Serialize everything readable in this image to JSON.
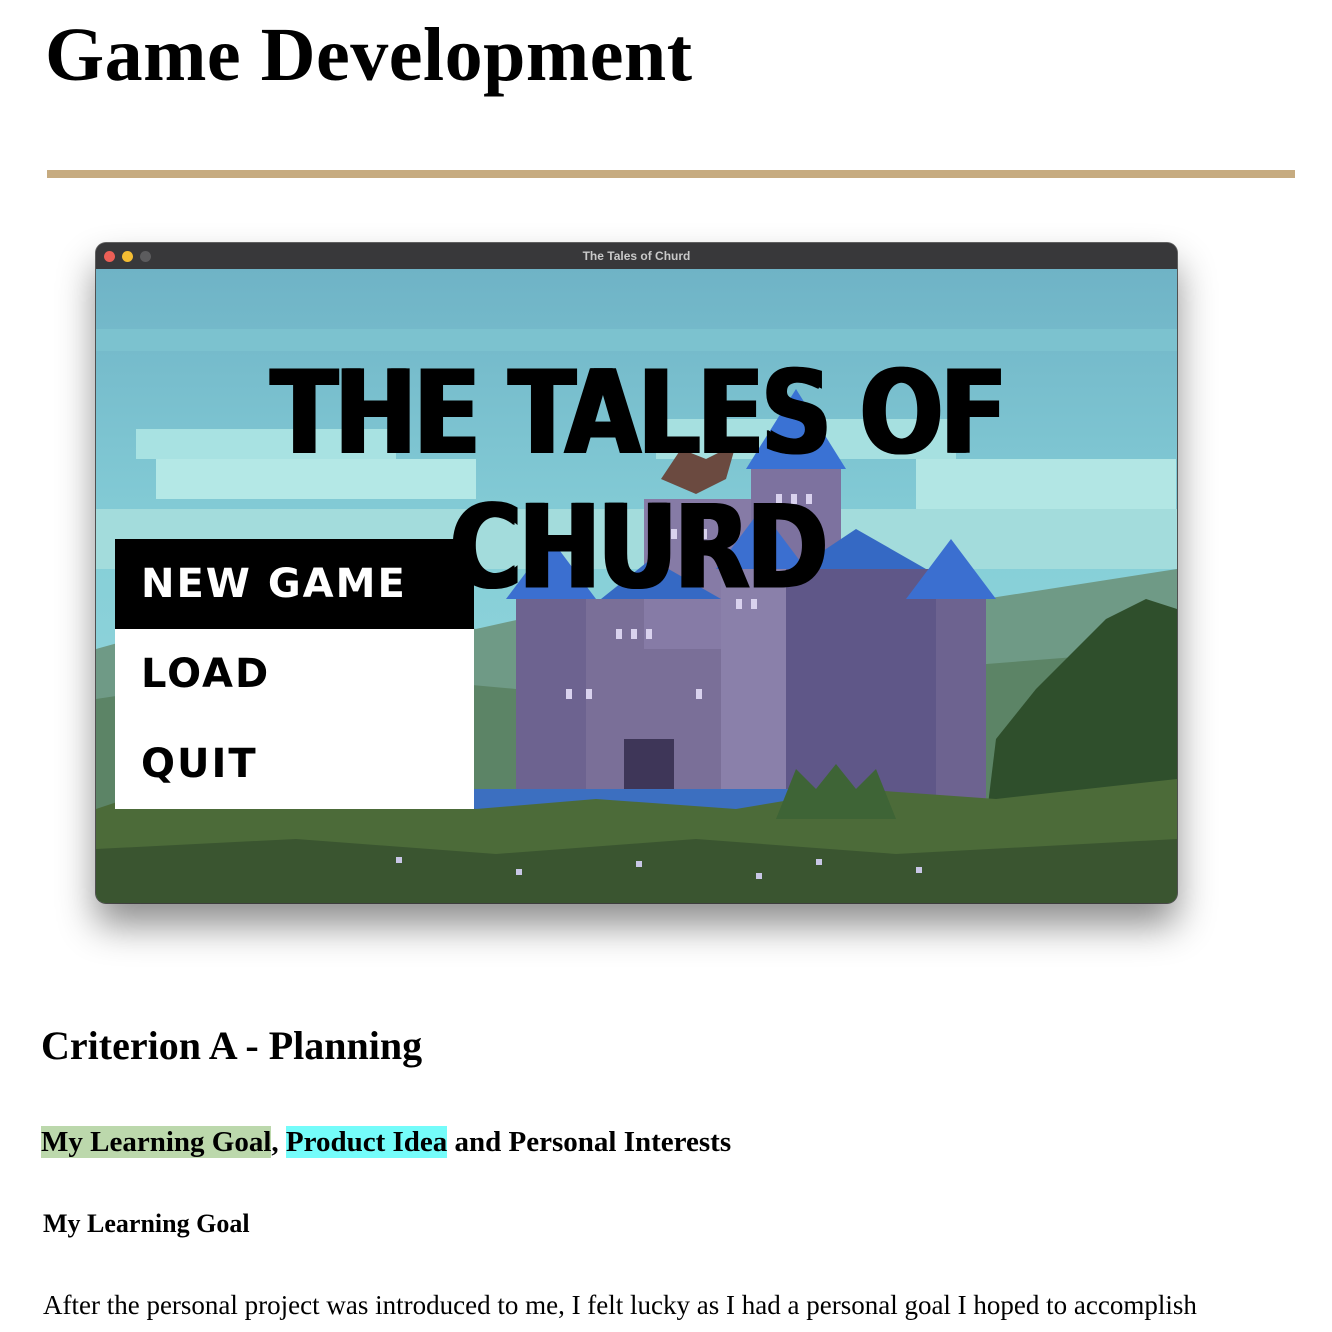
{
  "page": {
    "title": "Game Development",
    "rule_color": "#c6ab80"
  },
  "app_window": {
    "title": "The Tales of Churd",
    "game_title": "THE TALES OF CHURD",
    "menu": {
      "items": [
        {
          "label": "NEW GAME",
          "selected": true
        },
        {
          "label": "LOAD",
          "selected": false
        },
        {
          "label": "QUIT",
          "selected": false
        }
      ]
    }
  },
  "section": {
    "title": "Criterion A - Planning",
    "subheading": {
      "part1": "My Learning Goal",
      "sep1": ", ",
      "part2": "Product Idea",
      "part3": " and Personal Interests",
      "highlight1_color": "#bcd8ac",
      "highlight2_color": "#74fcfa"
    },
    "subsubheading": "My Learning Goal",
    "body": "After the personal project was introduced to me, I felt lucky as I had a personal goal I hoped to accomplish"
  }
}
